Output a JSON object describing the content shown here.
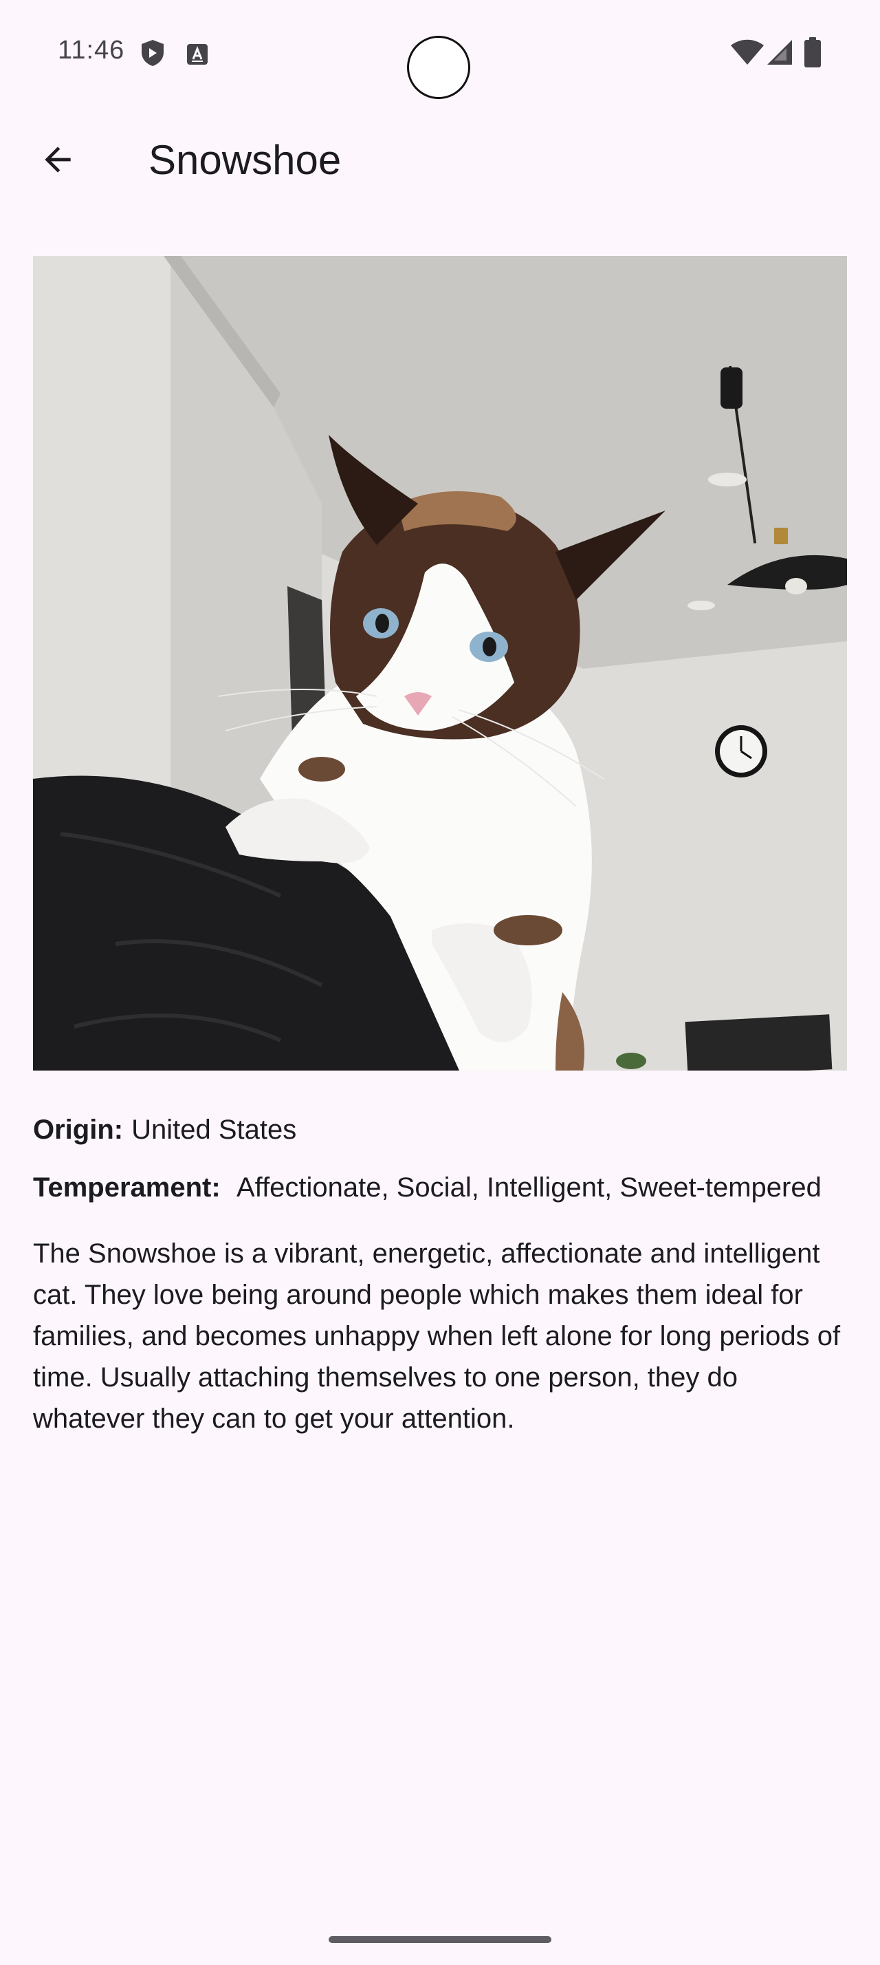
{
  "status_bar": {
    "time": "11:46",
    "left_icons": [
      "shield-icon",
      "keyboard-a-icon"
    ],
    "right_icons": [
      "wifi-icon",
      "cellular-signal-icon",
      "battery-icon"
    ]
  },
  "app_bar": {
    "back_icon": "arrow-back-icon",
    "title": "Snowshoe"
  },
  "image": {
    "subject": "cat-photo"
  },
  "details": {
    "origin_label": "Origin:",
    "origin_value": "United States",
    "temperament_label": "Temperament:",
    "temperament_value": "Affectionate, Social, Intelligent, Sweet-tempered",
    "description": "The Snowshoe is a vibrant, energetic, affectionate and intelligent cat. They love being around people which makes them ideal for families, and becomes unhappy when left alone for long periods of time. Usually attaching themselves to one person, they do whatever they can to get your attention."
  },
  "colors": {
    "background": "#fdf7fd",
    "text": "#1c1b1f",
    "status_text": "#454347"
  }
}
